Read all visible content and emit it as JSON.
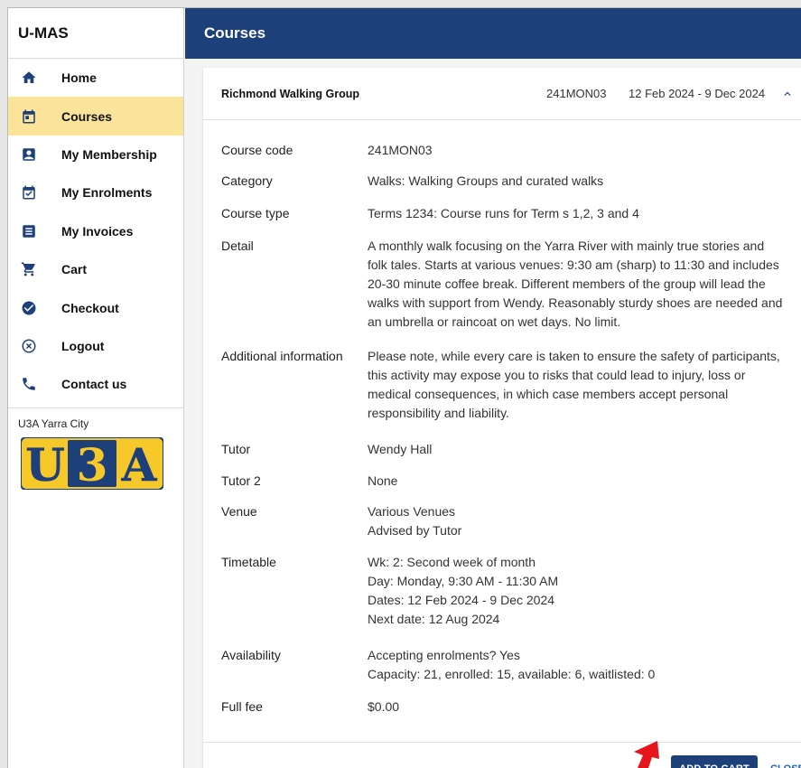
{
  "app": {
    "title": "U-MAS"
  },
  "sidebar": {
    "items": [
      {
        "label": "Home",
        "icon": "home-icon",
        "active": false
      },
      {
        "label": "Courses",
        "icon": "calendar-icon",
        "active": true
      },
      {
        "label": "My Membership",
        "icon": "membership-icon",
        "active": false
      },
      {
        "label": "My Enrolments",
        "icon": "calendar-check-icon",
        "active": false
      },
      {
        "label": "My Invoices",
        "icon": "invoice-icon",
        "active": false
      },
      {
        "label": "Cart",
        "icon": "cart-icon",
        "active": false
      },
      {
        "label": "Checkout",
        "icon": "check-circle-icon",
        "active": false
      },
      {
        "label": "Logout",
        "icon": "close-circle-icon",
        "active": false
      },
      {
        "label": "Contact us",
        "icon": "phone-icon",
        "active": false
      }
    ],
    "org_name": "U3A Yarra City",
    "logo_text": [
      "U",
      "3",
      "A"
    ]
  },
  "header": {
    "title": "Courses"
  },
  "course": {
    "title": "Richmond Walking Group",
    "code_head": "241MON03",
    "dates_head": "12 Feb 2024 - 9 Dec 2024",
    "fields": {
      "course_code": {
        "label": "Course code",
        "value": "241MON03"
      },
      "category": {
        "label": "Category",
        "value": "Walks: Walking Groups and curated walks"
      },
      "course_type": {
        "label": "Course type",
        "value": "Terms 1234: Course runs for Term s 1,2, 3 and 4"
      },
      "detail": {
        "label": "Detail",
        "lines": [
          "A monthly walk focusing on the Yarra River with mainly true stories and",
          "folk tales. Starts at various venues: 9:30 am (sharp) to 11:30 and includes",
          "20-30 minute coffee break. Different members of the group will lead the",
          "walks with support from Wendy. Reasonably sturdy shoes are needed and",
          "an umbrella or raincoat on wet days. No limit."
        ]
      },
      "additional": {
        "label": "Additional information",
        "lines": [
          "Please note, while every care is taken to ensure the safety of participants,",
          "this activity may expose you to risks that could lead to injury, loss or",
          "medical consequences, in which case members accept personal",
          "responsibility and liability."
        ]
      },
      "tutor": {
        "label": "Tutor",
        "value": "Wendy Hall"
      },
      "tutor2": {
        "label": "Tutor 2",
        "value": "None"
      },
      "venue": {
        "label": "Venue",
        "lines": [
          "Various Venues",
          "Advised by Tutor"
        ]
      },
      "timetable": {
        "label": "Timetable",
        "lines": [
          "Wk: 2: Second week of month",
          "Day: Monday, 9:30 AM - 11:30 AM",
          "Dates: 12 Feb 2024 - 9 Dec 2024",
          "Next date: 12 Aug 2024"
        ]
      },
      "availability": {
        "label": "Availability",
        "lines": [
          "Accepting enrolments? Yes",
          "Capacity: 21, enrolled: 15, available: 6, waitlisted: 0"
        ]
      },
      "fee": {
        "label": "Full fee",
        "value": "$0.00"
      }
    },
    "actions": {
      "add_to_cart": "ADD TO CART",
      "close": "CLOSE"
    }
  },
  "colors": {
    "primary": "#1d3f7a",
    "active_bg": "#fbe49a",
    "logo_yellow": "#f7c82a",
    "pointer": "#e8141b"
  }
}
